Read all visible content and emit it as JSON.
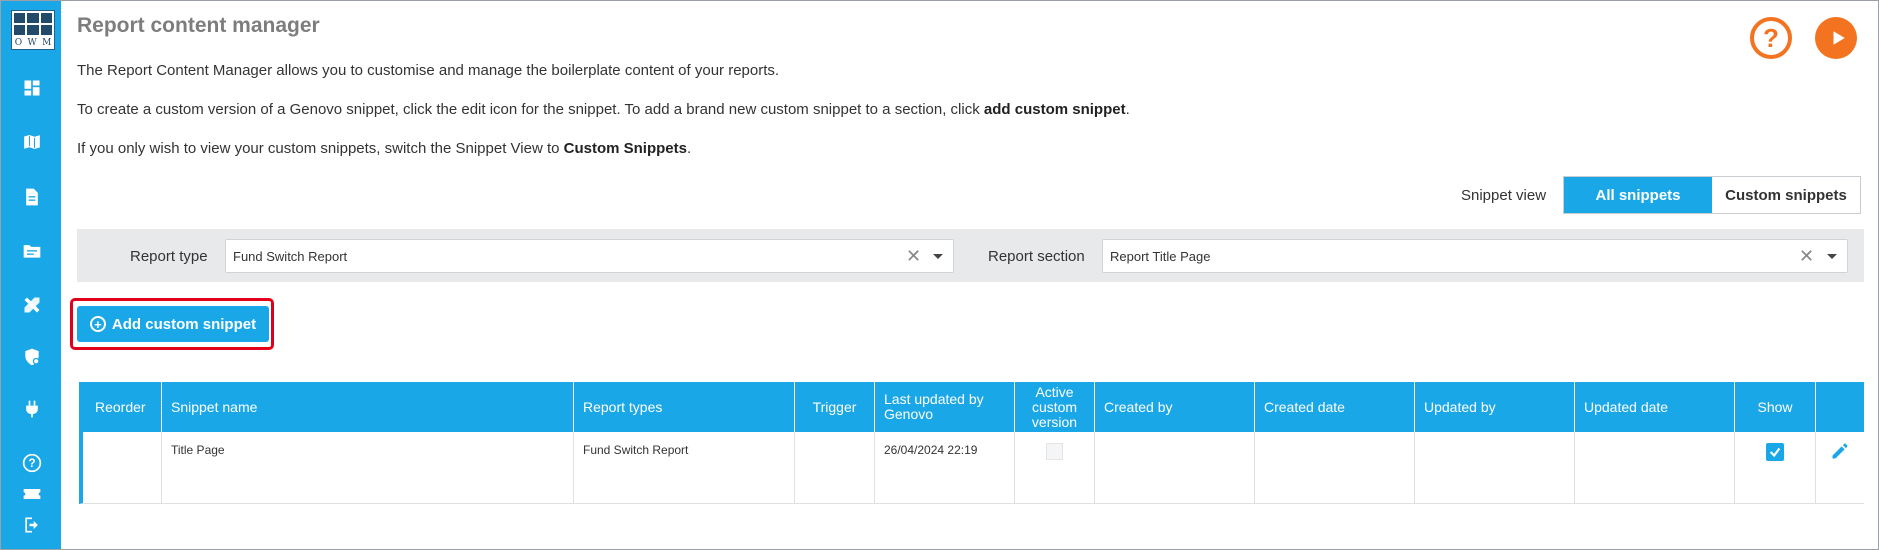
{
  "app": {
    "logo_letters": [
      "O",
      "W",
      "M"
    ]
  },
  "sidebar": {
    "items": [
      {
        "icon": "dashboard-icon"
      },
      {
        "icon": "book-map-icon"
      },
      {
        "icon": "document-icon"
      },
      {
        "icon": "folder-list-icon"
      },
      {
        "icon": "tools-icon"
      },
      {
        "icon": "shield-settings-icon"
      },
      {
        "icon": "plug-icon"
      },
      {
        "icon": "help-circle-icon"
      },
      {
        "icon": "ticket-icon"
      },
      {
        "icon": "logout-icon"
      }
    ]
  },
  "header": {
    "title": "Report content manager"
  },
  "intro": {
    "line1": "The Report Content Manager allows you to customise and manage the boilerplate content of your reports.",
    "line2_pre": "To create a custom version of a Genovo snippet, click the edit icon for the snippet. To add a brand new custom snippet to a section, click ",
    "line2_bold": "add custom snippet",
    "line2_post": ".",
    "line3_pre": "If you only wish to view your custom snippets, switch the Snippet View to ",
    "line3_bold": "Custom Snippets",
    "line3_post": "."
  },
  "top_actions": {
    "help_glyph": "?",
    "colors": {
      "accent": "#f37321"
    }
  },
  "snippet_view": {
    "label": "Snippet view",
    "options": [
      "All snippets",
      "Custom snippets"
    ],
    "selected": "All snippets"
  },
  "filters": {
    "report_type_label": "Report type",
    "report_type_value": "Fund Switch Report",
    "report_section_label": "Report section",
    "report_section_value": "Report Title Page",
    "clear_glyph": "✕"
  },
  "add_button": {
    "label": "Add custom snippet",
    "plus_glyph": "+"
  },
  "table": {
    "columns": [
      {
        "label": "Reorder"
      },
      {
        "label": "Snippet name"
      },
      {
        "label": "Report types"
      },
      {
        "label": "Trigger"
      },
      {
        "label": "Last updated by Genovo"
      },
      {
        "label": "Active custom version"
      },
      {
        "label": "Created by"
      },
      {
        "label": "Created date"
      },
      {
        "label": "Updated by"
      },
      {
        "label": "Updated date"
      },
      {
        "label": "Show"
      },
      {
        "label": ""
      }
    ],
    "rows": [
      {
        "reorder": "",
        "snippet_name": "Title Page",
        "report_types": "Fund Switch Report",
        "trigger": "",
        "last_updated": "26/04/2024 22:19",
        "active_custom_version": false,
        "created_by": "",
        "created_date": "",
        "updated_by": "",
        "updated_date": "",
        "show": true
      }
    ]
  },
  "colors": {
    "primary": "#1aa7e8",
    "highlight_border": "#e0001b",
    "title_gray": "#7d7d7d",
    "filter_bg": "#e7e9eb"
  }
}
